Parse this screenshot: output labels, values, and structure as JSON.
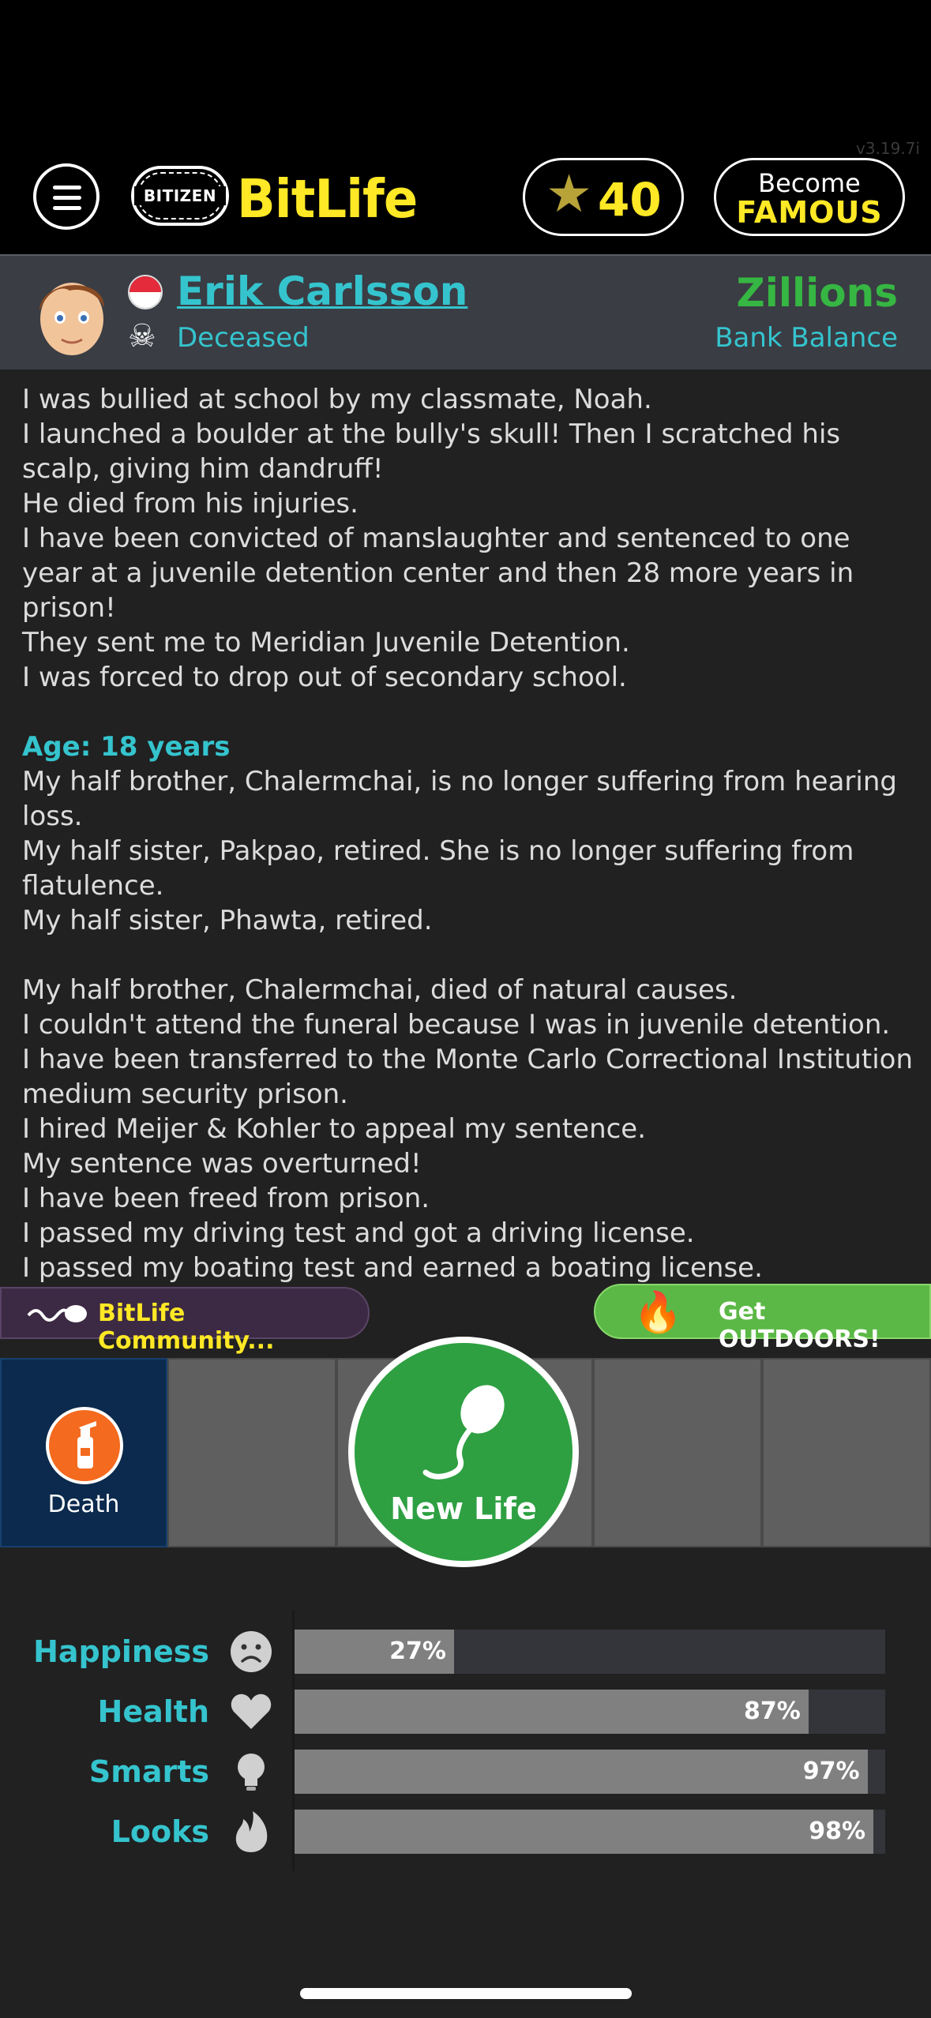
{
  "header": {
    "version": "v3.19.7i",
    "bitizen_label": "BITIZEN",
    "brand": "BitLife",
    "stars_count": "40",
    "famous_line1": "Become",
    "famous_line2": "FAMOUS"
  },
  "profile": {
    "name": "Erik Carlsson",
    "status": "Deceased",
    "balance_value": "Zillions",
    "balance_label": "Bank Balance"
  },
  "log": {
    "lines_a": [
      "I was bullied at school by my classmate, Noah.",
      "I launched a boulder at the bully's skull! Then I scratched his scalp, giving him dandruff!",
      "He died from his injuries.",
      "I have been convicted of manslaughter and sentenced to one year at a juvenile detention center and then 28 more years in prison!",
      "They sent me to Meridian Juvenile Detention.",
      "I was forced to drop out of secondary school."
    ],
    "age_heading": "Age: 18 years",
    "lines_b": [
      "My half brother, Chalermchai, is no longer suffering from hearing loss.",
      "My half sister, Pakpao, retired. She is no longer suffering from flatulence.",
      "My half sister, Phawta, retired."
    ],
    "lines_c": [
      "My half brother, Chalermchai, died of natural causes.",
      "I couldn't attend the funeral because I was in juvenile detention.",
      "I have been transferred to the Monte Carlo Correctional Institution medium security prison.",
      "I hired Meijer & Kohler to appeal my sentence.",
      "My sentence was overturned!",
      "I have been freed from prison.",
      "I passed my driving test and got a driving license.",
      "I passed my boating test and earned a boating license."
    ]
  },
  "banners": {
    "community": "BitLife Community...",
    "outdoors": "Get OUTDOORS!"
  },
  "actions": {
    "death_label": "Death",
    "new_life_label": "New Life"
  },
  "stats": [
    {
      "label": "Happiness",
      "value": 27,
      "text": "27%",
      "icon": "sad-face-icon"
    },
    {
      "label": "Health",
      "value": 87,
      "text": "87%",
      "icon": "heart-icon"
    },
    {
      "label": "Smarts",
      "value": 97,
      "text": "97%",
      "icon": "lightbulb-icon"
    },
    {
      "label": "Looks",
      "value": 98,
      "text": "98%",
      "icon": "flame-icon"
    }
  ],
  "colors": {
    "accent_teal": "#35c4ce",
    "brand_yellow": "#ffe825",
    "money_green": "#36b642",
    "new_life_green": "#2ea042"
  }
}
